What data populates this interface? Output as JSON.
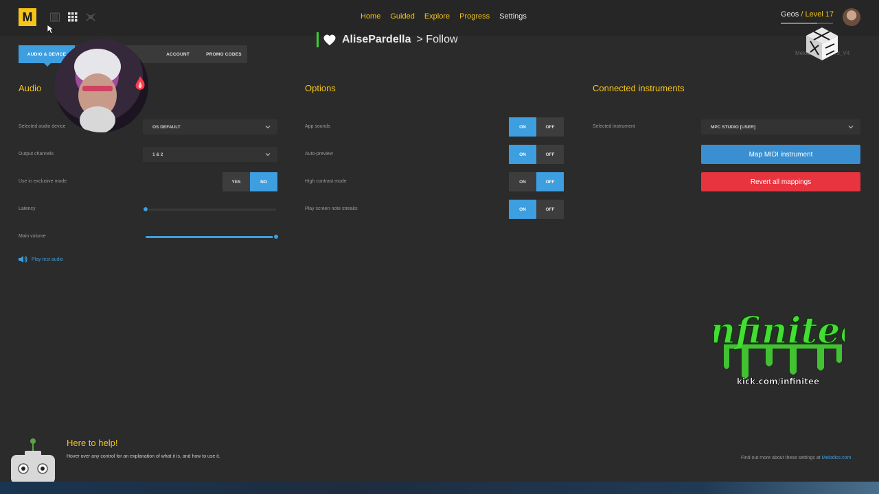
{
  "header": {
    "logo_text": "M",
    "view_icons": [
      "piano-view-icon",
      "grid-view-icon",
      "drum-view-icon"
    ],
    "nav": [
      {
        "label": "Home"
      },
      {
        "label": "Guided"
      },
      {
        "label": "Explore"
      },
      {
        "label": "Progress"
      },
      {
        "label": "Settings"
      }
    ],
    "user_name": "Geos",
    "user_level": "/ Level 17",
    "version": "Melodics 4.1.1773_V4"
  },
  "stream_overlay": {
    "name": "AlisePardella",
    "follow": "> Follow"
  },
  "tabs": [
    {
      "label": "Audio & Device"
    },
    {
      "label": ""
    },
    {
      "label": "Account"
    },
    {
      "label": "Promo Codes"
    }
  ],
  "audio": {
    "title": "Audio",
    "device_label": "Selected audio device",
    "device_value": "OS DEFAULT",
    "channels_label": "Output channels",
    "channels_value": "1 & 2",
    "exclusive_label": "Use in exclusive mode",
    "exclusive_yes": "YES",
    "exclusive_no": "NO",
    "exclusive_selected": "NO",
    "latency_label": "Latency",
    "latency_level": 0.0,
    "volume_label": "Main volume",
    "volume_level": 1.0,
    "play_test": "Play test audio"
  },
  "options": {
    "title": "Options",
    "items": [
      {
        "label": "App sounds",
        "on": "ON",
        "off": "OFF",
        "state": "ON"
      },
      {
        "label": "Auto-preview",
        "on": "ON",
        "off": "OFF",
        "state": "ON"
      },
      {
        "label": "High contrast mode",
        "on": "ON",
        "off": "OFF",
        "state": "OFF"
      },
      {
        "label": "Play screen note streaks",
        "on": "ON",
        "off": "OFF",
        "state": "ON"
      }
    ]
  },
  "instruments": {
    "title": "Connected instruments",
    "selected_label": "Selected instrument",
    "selected_value": "MPC STUDIO [USER]",
    "map_button": "Map MIDI instrument",
    "revert_button": "Revert all mappings"
  },
  "branding": {
    "logo_text": "infinitee",
    "url": "kick.com/infinitee"
  },
  "help": {
    "title": "Here to help!",
    "text": "Hover over any control for an explanation of what it is, and how to use it.",
    "find_more": "Find out more about these settings at",
    "link": "Melodics.com"
  },
  "colors": {
    "accent_yellow": "#f5c518",
    "accent_blue": "#3d9ee0",
    "danger_red": "#e8343f",
    "background": "#2b2b2b"
  }
}
